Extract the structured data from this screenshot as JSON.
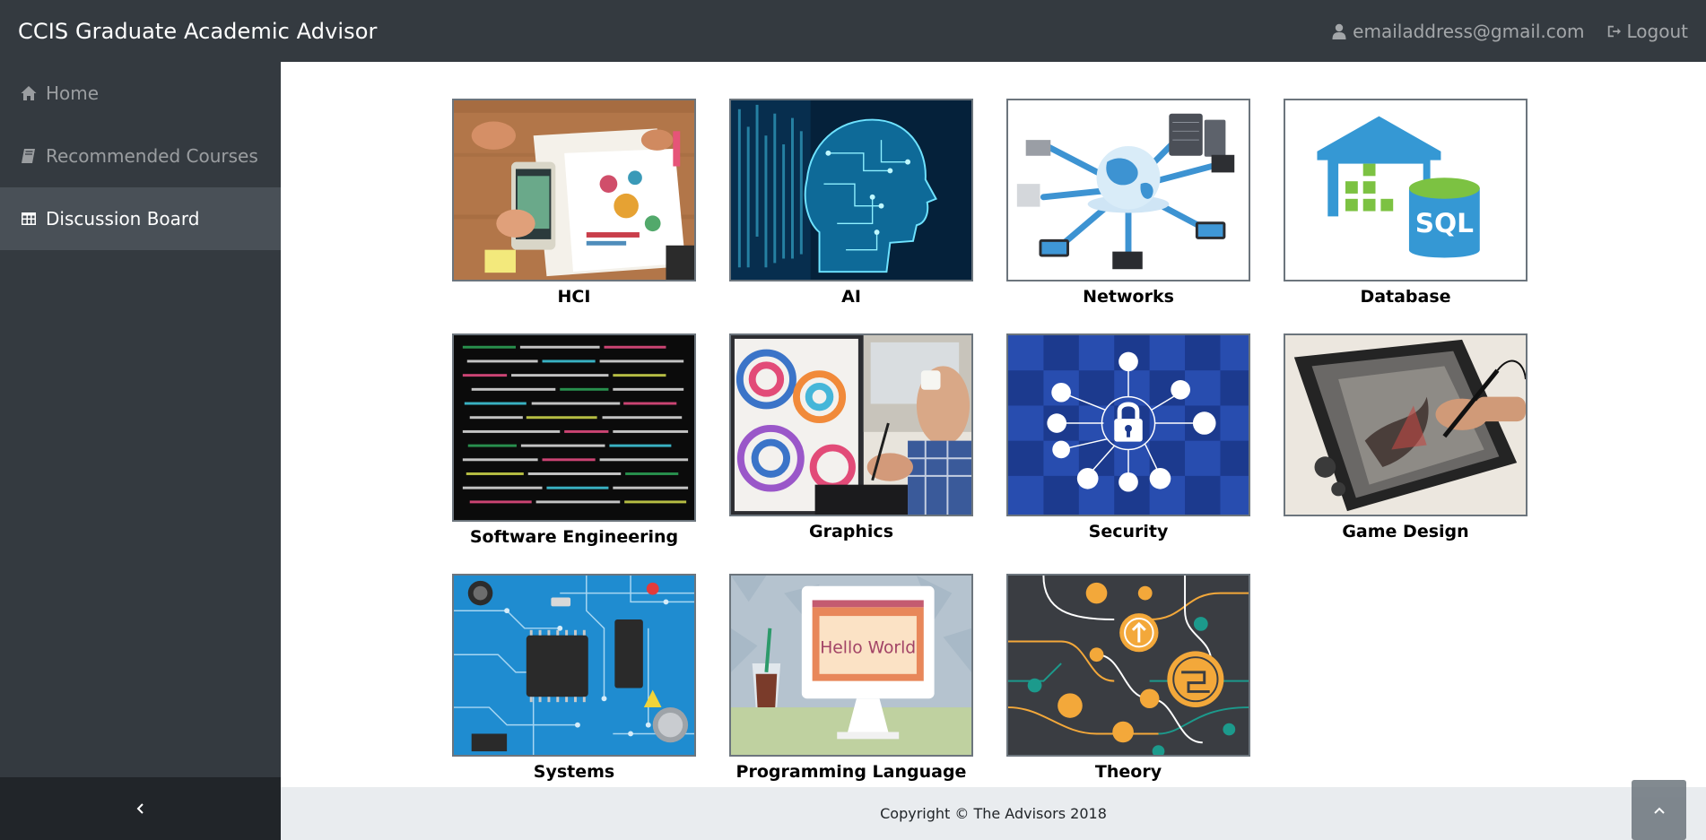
{
  "app": {
    "title": "CCIS Graduate Academic Advisor",
    "user_email": "emailaddress@gmail.com",
    "logout_label": "Logout"
  },
  "sidebar": {
    "items": [
      {
        "label": "Home",
        "icon": "home-icon",
        "active": false
      },
      {
        "label": "Recommended Courses",
        "icon": "book-icon",
        "active": false
      },
      {
        "label": "Discussion Board",
        "icon": "table-icon",
        "active": true
      }
    ]
  },
  "topics": [
    {
      "label": "HCI"
    },
    {
      "label": "AI"
    },
    {
      "label": "Networks"
    },
    {
      "label": "Database"
    },
    {
      "label": "Software Engineering"
    },
    {
      "label": "Graphics"
    },
    {
      "label": "Security"
    },
    {
      "label": "Game Design"
    },
    {
      "label": "Systems"
    },
    {
      "label": "Programming Language"
    },
    {
      "label": "Theory"
    }
  ],
  "images": {
    "database_text": "SQL",
    "programming_text": "Hello World"
  },
  "footer": {
    "copyright": "Copyright © The Advisors 2018"
  },
  "colors": {
    "navbar": "#343a40",
    "sidebar_active": "#495057",
    "footer": "#e9ecef"
  }
}
